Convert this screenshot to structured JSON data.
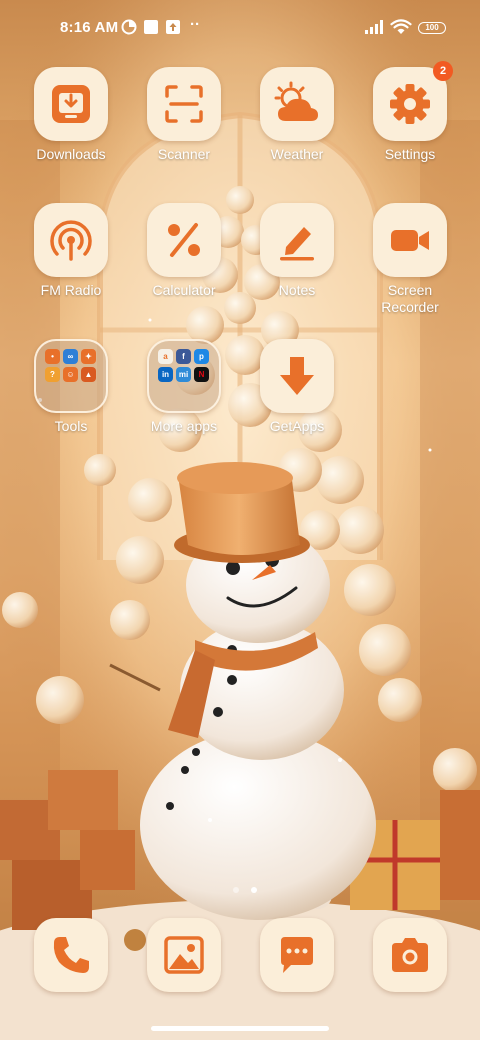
{
  "status_bar": {
    "time": "8:16 AM",
    "battery": "100",
    "dots": "··",
    "icons": [
      "data-saver-icon",
      "notification-square-icon",
      "upload-icon",
      "signal-icon",
      "wifi-icon",
      "battery-icon"
    ]
  },
  "apps": {
    "row1": [
      {
        "label": "Downloads",
        "icon": "download-icon"
      },
      {
        "label": "Scanner",
        "icon": "scan-icon"
      },
      {
        "label": "Weather",
        "icon": "sun-cloud-icon"
      },
      {
        "label": "Settings",
        "icon": "gear-icon",
        "badge": "2"
      }
    ],
    "row2": [
      {
        "label": "FM Radio",
        "icon": "radio-icon"
      },
      {
        "label": "Calculator",
        "icon": "percent-icon"
      },
      {
        "label": "Notes",
        "icon": "pen-icon"
      },
      {
        "label": "Screen\nRecorder",
        "icon": "video-camera-icon"
      }
    ],
    "row3": [
      {
        "label": "Tools",
        "icon": "folder-icon"
      },
      {
        "label": "More apps",
        "icon": "folder-icon"
      },
      {
        "label": "GetApps",
        "icon": "arrow-down-icon"
      }
    ]
  },
  "folder_minis": {
    "tools": [
      "•",
      "∞",
      "✦",
      "?",
      "☺",
      "▲"
    ],
    "more_apps": [
      "a",
      "f",
      "p",
      "in",
      "mi",
      "N"
    ]
  },
  "dock": [
    {
      "icon": "phone-icon"
    },
    {
      "icon": "gallery-icon"
    },
    {
      "icon": "messages-icon"
    },
    {
      "icon": "camera-icon"
    }
  ],
  "page_indicator": {
    "pages": 2,
    "current": 2
  },
  "colors": {
    "accent": "#e8702a",
    "tile": "#fbeed9",
    "badge": "#f25a22"
  }
}
